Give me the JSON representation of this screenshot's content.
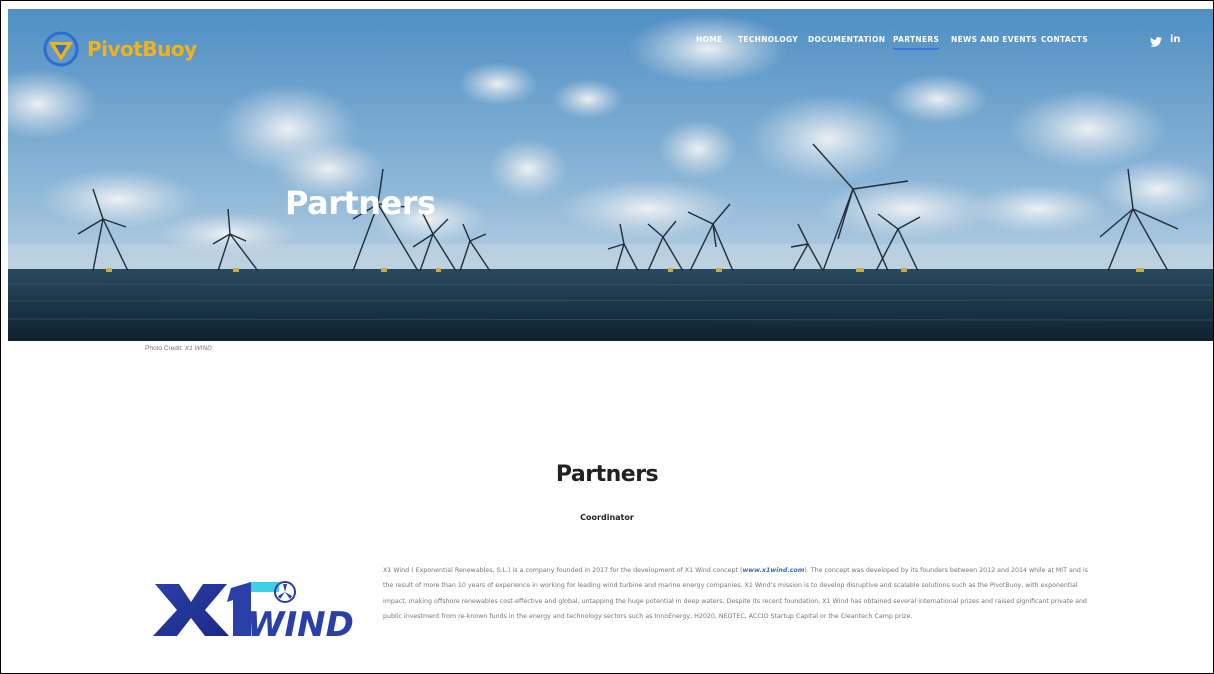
{
  "brand": {
    "name_part1": "Pivot",
    "name_part2": "Buoy"
  },
  "nav": {
    "items": [
      {
        "label": "HOME"
      },
      {
        "label": "TECHNOLOGY"
      },
      {
        "label": "DOCUMENTATION"
      },
      {
        "label": "PARTNERS",
        "active": true
      },
      {
        "label": "NEWS AND EVENTS"
      },
      {
        "label": "CONTACTS"
      }
    ],
    "social": {
      "twitter_icon": "twitter-icon",
      "linkedin_label": "in"
    }
  },
  "hero": {
    "title": "Partners"
  },
  "photo_credit": {
    "prefix": "Photo Credit: ",
    "source": "X1 WIND"
  },
  "main": {
    "section_title": "Partners",
    "coordinator_label": "Coordinator",
    "partner": {
      "logo_text": "X1WIND",
      "description_before_link": "X1 Wind ( Exponential Renewables, S.L.) is a company founded in 2017 for the development of X1 Wind concept (",
      "link_text": "www.x1wind.com",
      "description_after_link": "). The concept was developed by its founders between 2012 and 2014 while at MIT and is the result of more than 10 years of experience in working for leading wind turbine and marine energy companies. X1 Wind’s mission is to develop disruptive and scalable solutions such as the PivotBuoy, with exponential impact, making offshore renewables cost-effective and global, untapping the huge potential in deep waters. Despite its recent foundation, X1 Wind has obtained several international prizes and raised significant private and public investment from re-known funds in the energy and technology sectors such as InnoEnergy, H2020, NEOTEC, ACCIO Startup Capital or the Cleantech Camp prize."
    }
  },
  "colors": {
    "accent_yellow": "#f2b21d",
    "accent_blue": "#3b7bdc",
    "text_dark": "#222222",
    "text_muted": "#777777"
  }
}
